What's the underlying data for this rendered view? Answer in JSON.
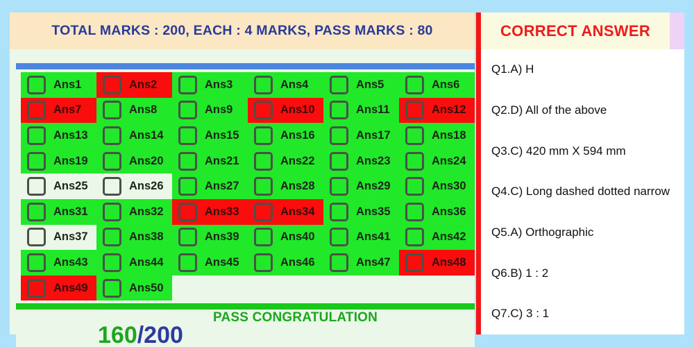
{
  "page": {
    "background_color": "#ADE2FA"
  },
  "left_panel": {
    "marks_header": {
      "text": "TOTAL MARKS : 200,   EACH : 4 MARKS, PASS MARKS : 80",
      "background_color": "#FCE7C5",
      "text_color": "#2A3A97"
    },
    "divider_color": "#4C87DD",
    "legend": {
      "correct_color": "#22E82A",
      "wrong_color": "#F90D0D",
      "blank_color": "#EBF7E8"
    },
    "answers": [
      {
        "label": "Ans1",
        "state": "correct"
      },
      {
        "label": "Ans2",
        "state": "wrong"
      },
      {
        "label": "Ans3",
        "state": "correct"
      },
      {
        "label": "Ans4",
        "state": "correct"
      },
      {
        "label": "Ans5",
        "state": "correct"
      },
      {
        "label": "Ans6",
        "state": "correct"
      },
      {
        "label": "Ans7",
        "state": "wrong"
      },
      {
        "label": "Ans8",
        "state": "correct"
      },
      {
        "label": "Ans9",
        "state": "correct"
      },
      {
        "label": "Ans10",
        "state": "wrong"
      },
      {
        "label": "Ans11",
        "state": "correct"
      },
      {
        "label": "Ans12",
        "state": "wrong"
      },
      {
        "label": "Ans13",
        "state": "correct"
      },
      {
        "label": "Ans14",
        "state": "correct"
      },
      {
        "label": "Ans15",
        "state": "correct"
      },
      {
        "label": "Ans16",
        "state": "correct"
      },
      {
        "label": "Ans17",
        "state": "correct"
      },
      {
        "label": "Ans18",
        "state": "correct"
      },
      {
        "label": "Ans19",
        "state": "correct"
      },
      {
        "label": "Ans20",
        "state": "correct"
      },
      {
        "label": "Ans21",
        "state": "correct"
      },
      {
        "label": "Ans22",
        "state": "correct"
      },
      {
        "label": "Ans23",
        "state": "correct"
      },
      {
        "label": "Ans24",
        "state": "correct"
      },
      {
        "label": "Ans25",
        "state": "blank"
      },
      {
        "label": "Ans26",
        "state": "blank"
      },
      {
        "label": "Ans27",
        "state": "correct"
      },
      {
        "label": "Ans28",
        "state": "correct"
      },
      {
        "label": "Ans29",
        "state": "correct"
      },
      {
        "label": "Ans30",
        "state": "correct"
      },
      {
        "label": "Ans31",
        "state": "correct"
      },
      {
        "label": "Ans32",
        "state": "correct"
      },
      {
        "label": "Ans33",
        "state": "wrong"
      },
      {
        "label": "Ans34",
        "state": "wrong"
      },
      {
        "label": "Ans35",
        "state": "correct"
      },
      {
        "label": "Ans36",
        "state": "correct"
      },
      {
        "label": "Ans37",
        "state": "blank"
      },
      {
        "label": "Ans38",
        "state": "correct"
      },
      {
        "label": "Ans39",
        "state": "correct"
      },
      {
        "label": "Ans40",
        "state": "correct"
      },
      {
        "label": "Ans41",
        "state": "correct"
      },
      {
        "label": "Ans42",
        "state": "correct"
      },
      {
        "label": "Ans43",
        "state": "correct"
      },
      {
        "label": "Ans44",
        "state": "correct"
      },
      {
        "label": "Ans45",
        "state": "correct"
      },
      {
        "label": "Ans46",
        "state": "correct"
      },
      {
        "label": "Ans47",
        "state": "correct"
      },
      {
        "label": "Ans48",
        "state": "wrong"
      },
      {
        "label": "Ans49",
        "state": "wrong"
      },
      {
        "label": "Ans50",
        "state": "correct"
      }
    ],
    "score": {
      "pass_message": "PASS CONGRATULATION",
      "obtained": "160",
      "total": "/200",
      "obtained_color": "#20A520",
      "total_color": "#2E3A9E",
      "message_color": "#18A81B"
    }
  },
  "right_panel": {
    "header": {
      "title": "CORRECT ANSWER",
      "text_color": "#ED1C1C",
      "background_color": "#FBFAE0",
      "accent_color": "#EFD3F7"
    },
    "rail_color": "#F61414",
    "items": [
      {
        "text": "Q1.A) H"
      },
      {
        "text": "Q2.D) All of the above"
      },
      {
        "text": "Q3.C) 420 mm X 594 mm"
      },
      {
        "text": "Q4.C) Long dashed dotted narrow"
      },
      {
        "text": "Q5.A) Orthographic"
      },
      {
        "text": "Q6.B) 1 : 2"
      },
      {
        "text": "Q7.C) 3 : 1"
      }
    ]
  }
}
